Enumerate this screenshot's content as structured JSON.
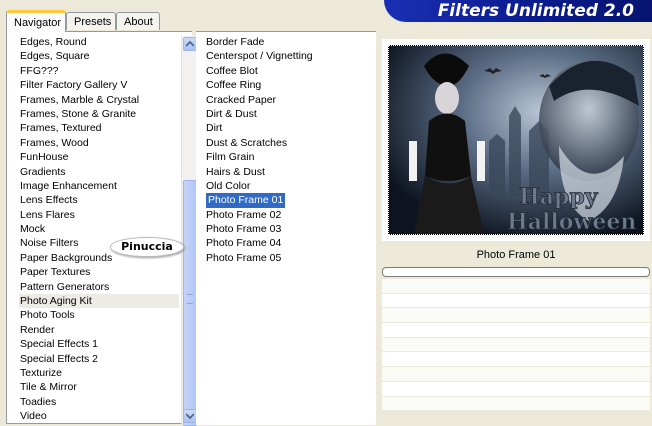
{
  "tabs": [
    {
      "label": "Navigator",
      "active": true
    },
    {
      "label": "Presets",
      "active": false
    },
    {
      "label": "About",
      "active": false
    }
  ],
  "banner": {
    "title": "Filters Unlimited 2.0"
  },
  "categories": [
    "Edges, Round",
    "Edges, Square",
    "FFG???",
    "Filter Factory Gallery V",
    "Frames, Marble & Crystal",
    "Frames, Stone & Granite",
    "Frames, Textured",
    "Frames, Wood",
    "FunHouse",
    "Gradients",
    "Image Enhancement",
    "Lens Effects",
    "Lens Flares",
    "Mock",
    "Noise Filters",
    "Paper Backgrounds",
    "Paper Textures",
    "Pattern Generators",
    "Photo Aging Kit",
    "Photo Tools",
    "Render",
    "Special Effects 1",
    "Special Effects 2",
    "Texturize",
    "Tile & Mirror",
    "Toadies",
    "Video"
  ],
  "selected_category": "Photo Aging Kit",
  "filters": [
    "Border Fade",
    "Centerspot / Vignetting",
    "Coffee Blot",
    "Coffee Ring",
    "Cracked Paper",
    "Dirt & Dust",
    "Dirt",
    "Dust & Scratches",
    "Film Grain",
    "Hairs & Dust",
    "Old Color",
    "Photo Frame 01",
    "Photo Frame 02",
    "Photo Frame 03",
    "Photo Frame 04",
    "Photo Frame 05"
  ],
  "selected_filter": "Photo Frame 01",
  "watermark": "Pinuccia",
  "preview": {
    "caption_line1": "Happy",
    "caption_line2": "Halloween"
  },
  "current_filter_label": "Photo Frame 01",
  "colors": {
    "selection": "#316ac5",
    "banner": "#0a1a8c",
    "tab_accent": "#ffc83c"
  }
}
